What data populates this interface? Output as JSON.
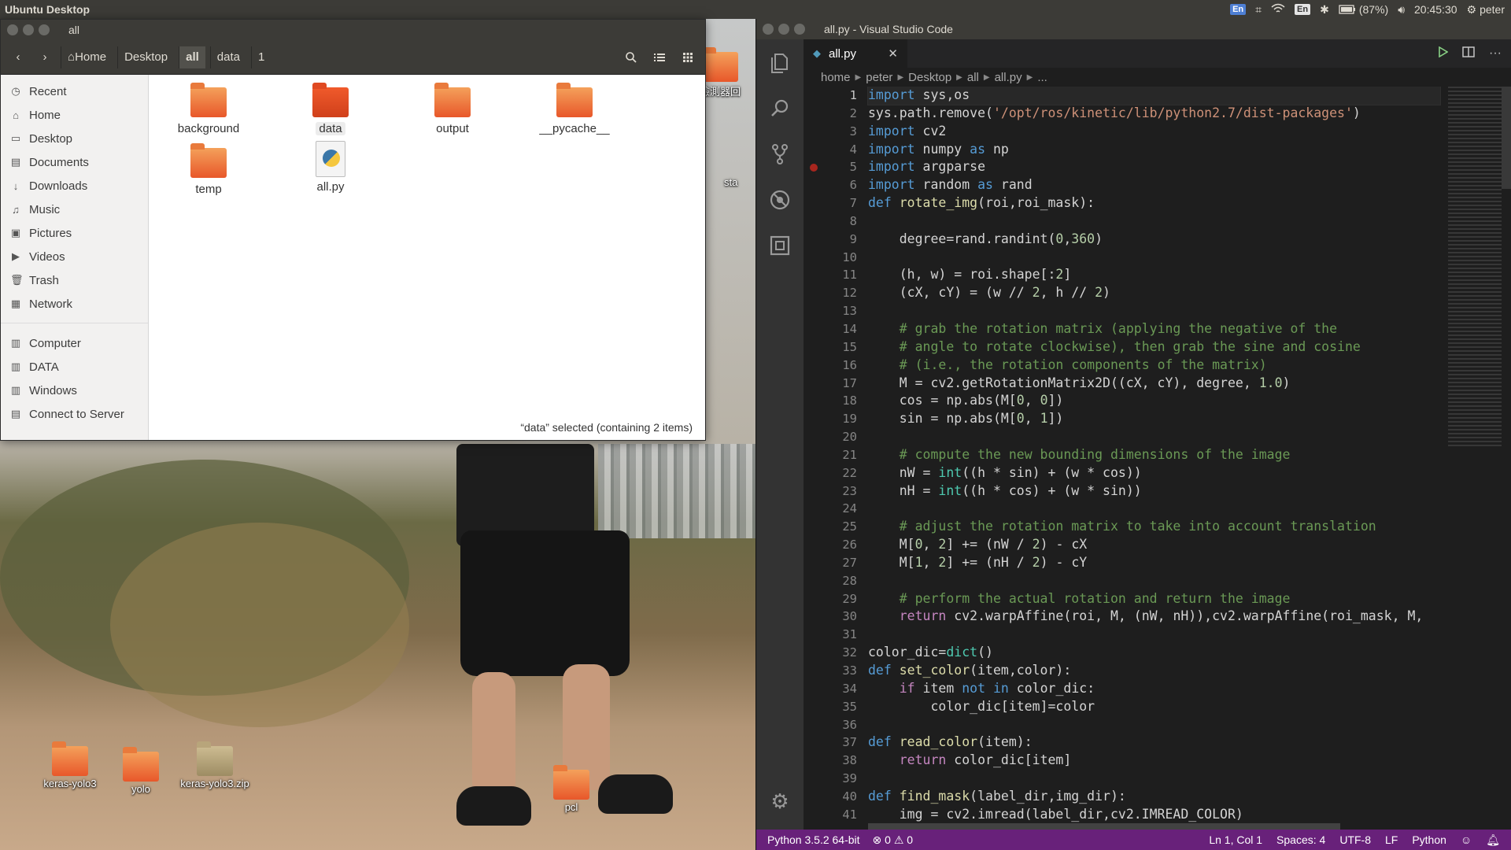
{
  "top_panel": {
    "title": "Ubuntu Desktop",
    "tray": {
      "input_method": "En",
      "keyboard_icon_text": "⌗",
      "input_lang": "En",
      "battery": "(87%)",
      "time": "20:45:30",
      "user": "peter"
    }
  },
  "desktop": {
    "icons": [
      {
        "label": "keras-yolo3",
        "type": "folder"
      },
      {
        "label": "yolo",
        "type": "folder"
      },
      {
        "label": "keras-yolo3.zip",
        "type": "zip"
      },
      {
        "label": "pcl",
        "type": "folder"
      }
    ],
    "partial_labels": {
      "folder_label": "檢測器回",
      "side_label": "sta"
    }
  },
  "file_manager": {
    "window_title": "all",
    "breadcrumbs": [
      "Home",
      "Desktop",
      "all",
      "data",
      "1"
    ],
    "active_crumb": "all",
    "places": [
      {
        "label": "Recent",
        "icon": "clock-icon"
      },
      {
        "label": "Home",
        "icon": "home-icon"
      },
      {
        "label": "Desktop",
        "icon": "desktop-icon"
      },
      {
        "label": "Documents",
        "icon": "documents-icon"
      },
      {
        "label": "Downloads",
        "icon": "download-icon"
      },
      {
        "label": "Music",
        "icon": "music-icon"
      },
      {
        "label": "Pictures",
        "icon": "pictures-icon"
      },
      {
        "label": "Videos",
        "icon": "videos-icon"
      },
      {
        "label": "Trash",
        "icon": "trash-icon"
      },
      {
        "label": "Network",
        "icon": "network-icon"
      }
    ],
    "devices": [
      {
        "label": "Computer",
        "icon": "drive-icon"
      },
      {
        "label": "DATA",
        "icon": "drive-icon"
      },
      {
        "label": "Windows",
        "icon": "drive-icon"
      },
      {
        "label": "Connect to Server",
        "icon": "server-icon"
      }
    ],
    "files": [
      {
        "label": "background",
        "type": "folder"
      },
      {
        "label": "data",
        "type": "folder",
        "selected": true
      },
      {
        "label": "output",
        "type": "folder"
      },
      {
        "label": "__pycache__",
        "type": "folder"
      },
      {
        "label": "temp",
        "type": "folder"
      },
      {
        "label": "all.py",
        "type": "python"
      }
    ],
    "status": "“data” selected  (containing 2 items)"
  },
  "vscode": {
    "window_title": "all.py - Visual Studio Code",
    "tab_label": "all.py",
    "breadcrumbs": [
      "home",
      "peter",
      "Desktop",
      "all",
      "all.py",
      "..."
    ],
    "current_line": 1,
    "breakpoint_line": 5,
    "code_lines": [
      "import sys,os",
      "sys.path.remove('/opt/ros/kinetic/lib/python2.7/dist-packages')",
      "import cv2",
      "import numpy as np",
      "import argparse",
      "import random as rand",
      "def rotate_img(roi,roi_mask):",
      "",
      "    degree=rand.randint(0,360)",
      "",
      "    (h, w) = roi.shape[:2]",
      "    (cX, cY) = (w // 2, h // 2)",
      "",
      "    # grab the rotation matrix (applying the negative of the",
      "    # angle to rotate clockwise), then grab the sine and cosine",
      "    # (i.e., the rotation components of the matrix)",
      "    M = cv2.getRotationMatrix2D((cX, cY), degree, 1.0)",
      "    cos = np.abs(M[0, 0])",
      "    sin = np.abs(M[0, 1])",
      "",
      "    # compute the new bounding dimensions of the image",
      "    nW = int((h * sin) + (w * cos))",
      "    nH = int((h * cos) + (w * sin))",
      "",
      "    # adjust the rotation matrix to take into account translation",
      "    M[0, 2] += (nW / 2) - cX",
      "    M[1, 2] += (nH / 2) - cY",
      "",
      "    # perform the actual rotation and return the image",
      "    return cv2.warpAffine(roi, M, (nW, nH)),cv2.warpAffine(roi_mask, M,",
      "",
      "color_dic=dict()",
      "def set_color(item,color):",
      "    if item not in color_dic:",
      "        color_dic[item]=color",
      "",
      "def read_color(item):",
      "    return color_dic[item]",
      "",
      "def find_mask(label_dir,img_dir):",
      "    img = cv2.imread(label_dir,cv2.IMREAD_COLOR)"
    ],
    "statusbar": {
      "interpreter": "Python 3.5.2 64-bit",
      "errors": "0",
      "warnings": "0",
      "position": "Ln 1, Col 1",
      "indent": "Spaces: 4",
      "encoding": "UTF-8",
      "eol": "LF",
      "language": "Python"
    },
    "colors": {
      "statusbar": "#68217a",
      "keyword": "#569cd6",
      "control": "#c586c0",
      "string": "#ce9178",
      "number": "#b5cea8",
      "comment": "#6a9955",
      "function": "#dcdcaa",
      "builtin": "#4ec9b0",
      "param": "#9cdcfe"
    }
  }
}
